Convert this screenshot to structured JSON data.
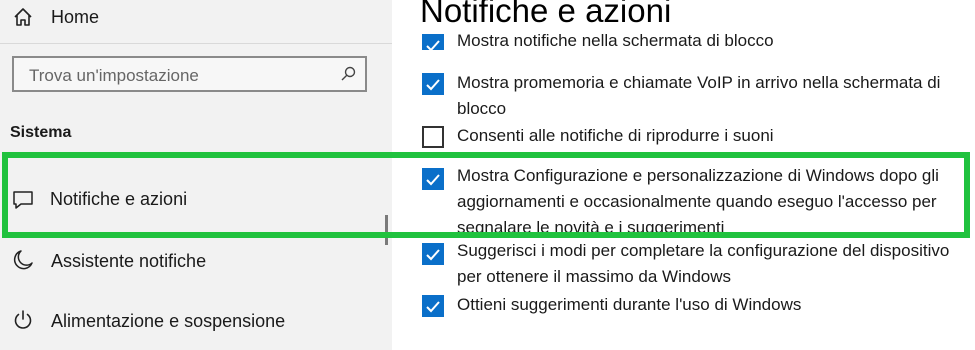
{
  "sidebar": {
    "home_label": "Home",
    "search_placeholder": "Trova un'impostazione",
    "section_title": "Sistema",
    "items": [
      {
        "label": "Notifiche e azioni",
        "icon": "speech-bubble-icon"
      },
      {
        "label": "Assistente notifiche",
        "icon": "moon-icon"
      },
      {
        "label": "Alimentazione e sospensione",
        "icon": "power-icon"
      }
    ]
  },
  "main": {
    "title": "Notifiche e azioni",
    "checkboxes": [
      {
        "label": "Mostra notifiche nella schermata di blocco",
        "checked": true
      },
      {
        "label": "Mostra promemoria e chiamate VoIP in arrivo nella schermata di blocco",
        "checked": true
      },
      {
        "label": "Consenti alle notifiche di riprodurre i suoni",
        "checked": false
      },
      {
        "label": "Mostra Configurazione e personalizzazione di Windows dopo gli aggiornamenti e occasionalmente quando eseguo l'accesso per segnalare le novità e i suggerimenti",
        "checked": true
      },
      {
        "label": "Suggerisci i modi per completare la configurazione del dispositivo per ottenere il massimo da Windows",
        "checked": true
      },
      {
        "label": "Ottieni suggerimenti durante l'uso di Windows",
        "checked": true
      }
    ]
  },
  "colors": {
    "accent": "#0a6fc9",
    "highlight": "#20c23e",
    "sidebar_bg": "#f2f2f2"
  }
}
